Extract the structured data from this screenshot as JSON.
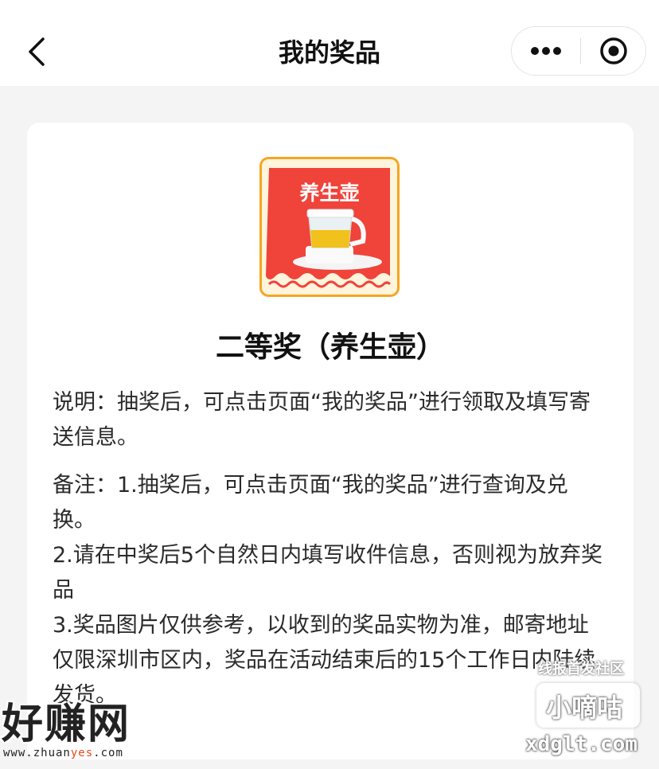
{
  "header": {
    "title": "我的奖品"
  },
  "prize": {
    "badge_text": "养生壶",
    "title": "二等奖（养生壶）"
  },
  "description": {
    "intro": "说明：抽奖后，可点击页面“我的奖品”进行领取及填写寄送信息。",
    "note_1": "备注：1.抽奖后，可点击页面“我的奖品”进行查询及兑换。",
    "note_2": "2.请在中奖后5个自然日内填写收件信息，否则视为放弃奖品",
    "note_3": "3.奖品图片仅供参考，以收到的奖品实物为准，邮寄地址仅限深圳市区内，奖品在活动结束后的15个工作日内陆续发货。"
  },
  "watermarks": {
    "left_big": "好赚网",
    "left_small_a": "www.zhuan",
    "left_small_b": "yes",
    "left_small_c": ".com",
    "right_top": "线报首发社区",
    "right_box": "小嘀咕",
    "right_url": "xdglt.com"
  },
  "colors": {
    "badge_red": "#f0433a",
    "badge_border": "#f5a623",
    "text": "#2a2a2a"
  }
}
